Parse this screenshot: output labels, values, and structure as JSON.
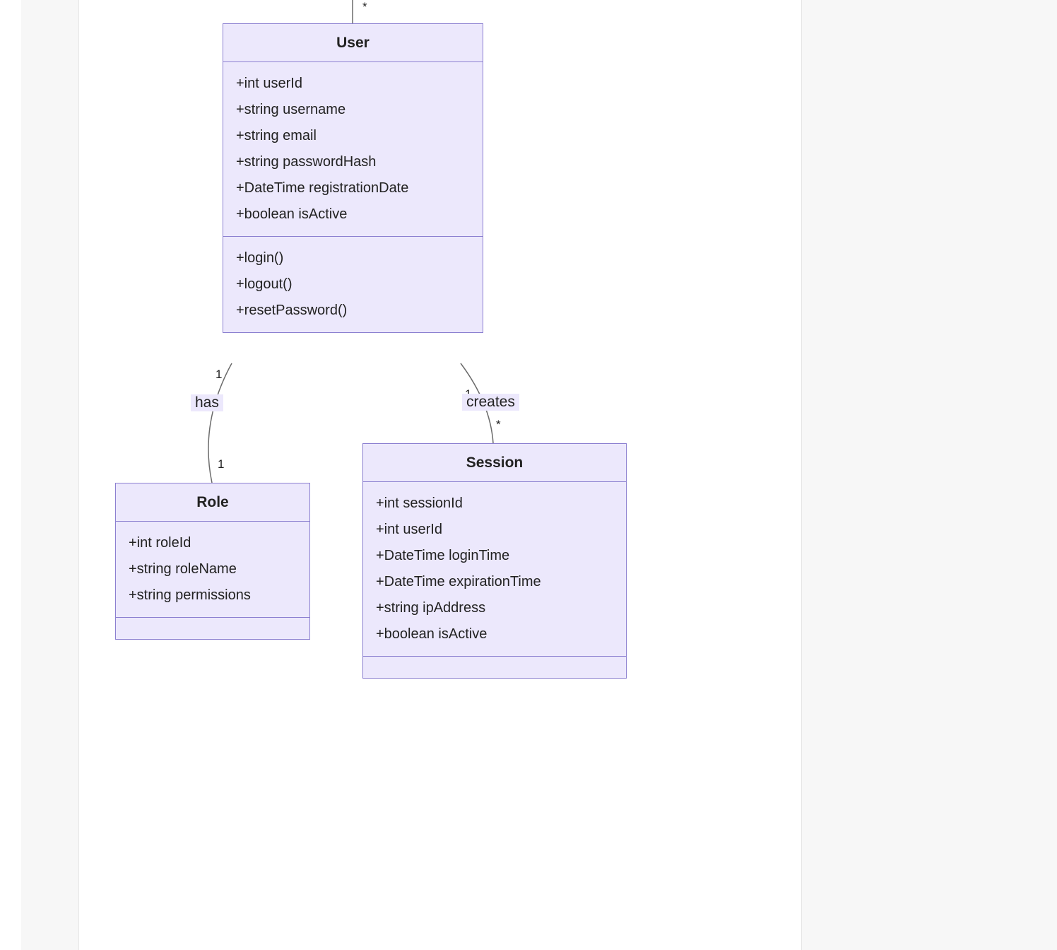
{
  "classes": {
    "user": {
      "name": "User",
      "attributes": [
        "+int userId",
        "+string username",
        "+string email",
        "+string passwordHash",
        "+DateTime registrationDate",
        "+boolean isActive"
      ],
      "methods": [
        "+login()",
        "+logout()",
        "+resetPassword()"
      ]
    },
    "role": {
      "name": "Role",
      "attributes": [
        "+int roleId",
        "+string roleName",
        "+string permissions"
      ],
      "methods": []
    },
    "session": {
      "name": "Session",
      "attributes": [
        "+int sessionId",
        "+int userId",
        "+DateTime loginTime",
        "+DateTime expirationTime",
        "+string ipAddress",
        "+boolean isActive"
      ],
      "methods": []
    }
  },
  "relationships": {
    "top": {
      "cardinality": "*"
    },
    "has": {
      "label": "has",
      "sourceCardinality": "1",
      "targetCardinality": "1"
    },
    "creates": {
      "label": "creates",
      "sourceCardinality": "1",
      "targetCardinality": "*"
    }
  },
  "colors": {
    "classFill": "#ece8fc",
    "classBorder": "#8b7fd0",
    "linkStroke": "#6b6b6b"
  }
}
